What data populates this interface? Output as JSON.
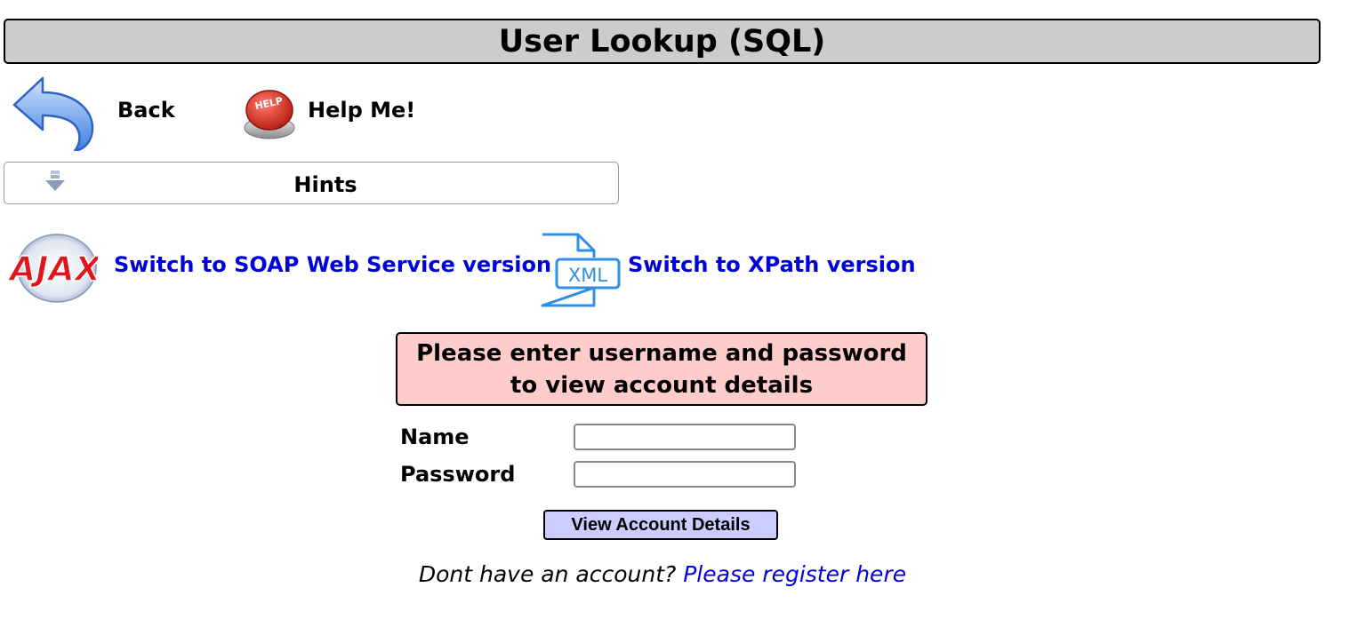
{
  "page_title": "User Lookup (SQL)",
  "nav": {
    "back_label": "Back",
    "help_label": "Help Me!",
    "help_icon_text": "HELP"
  },
  "hints": {
    "label": "Hints"
  },
  "switches": {
    "ajax_icon_text": "AJAX",
    "soap_label": "Switch to SOAP Web Service version",
    "xml_icon_text": "XML",
    "xpath_label": "Switch to XPath version"
  },
  "message": {
    "line1": "Please enter username and password",
    "line2": "to view account details"
  },
  "form": {
    "name_label": "Name",
    "name_value": "",
    "password_label": "Password",
    "password_value": "",
    "submit_label": "View Account Details"
  },
  "register": {
    "prompt": "Dont have an account?",
    "link_label": "Please register here"
  },
  "colors": {
    "title_bg": "#cccccc",
    "message_bg": "#ffcccc",
    "button_bg": "#ccccff",
    "link": "#0000dd"
  }
}
